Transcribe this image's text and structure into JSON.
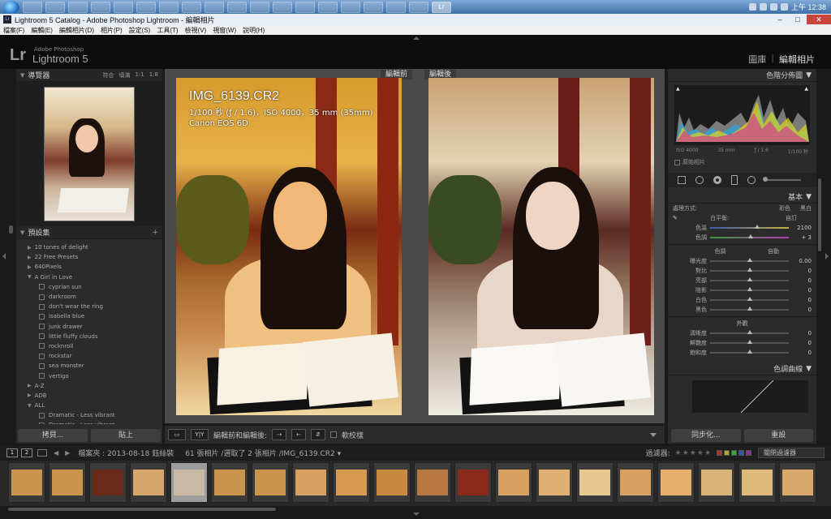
{
  "taskbar": {
    "apps": [
      "",
      "",
      "",
      "",
      "",
      "",
      "",
      "",
      "",
      "",
      "",
      "",
      "",
      "",
      "",
      "",
      "",
      "",
      "Lr"
    ],
    "clock": "上午 12:38"
  },
  "window": {
    "title": "Lightroom 5 Catalog - Adobe Photoshop Lightroom - 編輯相片",
    "buttons": [
      "–",
      "□",
      "✕"
    ]
  },
  "menu": [
    "檔案(F)",
    "編輯(E)",
    "編輯相片(D)",
    "相片(P)",
    "設定(S)",
    "工具(T)",
    "檢視(V)",
    "視窗(W)",
    "說明(H)"
  ],
  "identity": {
    "logo": "Lr",
    "brand_small": "Adobe Photoshop",
    "brand": "Lightroom 5",
    "modules": [
      "圖庫",
      "|",
      "編輯相片"
    ]
  },
  "left_panel": {
    "navigator": {
      "title": "導覽器",
      "zoom_options": [
        "符合",
        "填滿",
        "1:1",
        "1:8"
      ]
    },
    "presets": {
      "title": "預設集",
      "items": [
        {
          "type": "folder",
          "label": "10 tones of delight"
        },
        {
          "type": "folder",
          "label": "22 Free Presets"
        },
        {
          "type": "folder",
          "label": "640Pixels"
        },
        {
          "type": "folder-open",
          "label": "A Girl in Love"
        },
        {
          "type": "item",
          "label": "cyprian sun"
        },
        {
          "type": "item",
          "label": "darkroom"
        },
        {
          "type": "item",
          "label": "don't wear the ring"
        },
        {
          "type": "item",
          "label": "isabella blue"
        },
        {
          "type": "item",
          "label": "junk drawer"
        },
        {
          "type": "item",
          "label": "little fluffy clouds"
        },
        {
          "type": "item",
          "label": "rocknroll"
        },
        {
          "type": "item",
          "label": "rockstar"
        },
        {
          "type": "item",
          "label": "sea monster"
        },
        {
          "type": "item",
          "label": "vertigo"
        },
        {
          "type": "folder",
          "label": "A-Z"
        },
        {
          "type": "folder",
          "label": "ADB"
        },
        {
          "type": "folder-open",
          "label": "ALL"
        },
        {
          "type": "item",
          "label": "Dramatic - Less vibrant"
        },
        {
          "type": "item",
          "label": "Dramatic - Less vibrant"
        }
      ]
    },
    "copy_button": "拷貝...",
    "paste_button": "貼上"
  },
  "center": {
    "before_label": "編輯前",
    "after_label": "編輯後",
    "info": {
      "filename": "IMG_6139.CR2",
      "exif": "1/100 秒 (ƒ / 1.6)，ISO 4000，35 mm (35mm)",
      "camera": "Canon EOS 6D"
    },
    "toolbar": {
      "yy_label": "Y|Y",
      "compare_label": "編輯前和編輯後:",
      "softproof_label": "軟校樣"
    }
  },
  "right_panel": {
    "histogram_title": "色階分佈圖",
    "hist_info": [
      "ISO 4000",
      "35 mm",
      "ƒ / 1.6",
      "1/100 秒"
    ],
    "original_photo": "原始相片",
    "basic": {
      "title": "基本",
      "treatment_label": "處理方式:",
      "treatment_color": "彩色",
      "treatment_bw": "黑白",
      "wb_label": "白平衡:",
      "wb_value": "自訂",
      "sliders": [
        {
          "label": "色溫",
          "value": "2100",
          "pos": 0.6
        },
        {
          "label": "色調",
          "value": "+ 3",
          "pos": 0.52
        }
      ],
      "tone_title": "色調",
      "tone_auto": "自動",
      "tone_sliders": [
        {
          "label": "曝光度",
          "value": "0.00",
          "pos": 0.5
        },
        {
          "label": "對比",
          "value": "0",
          "pos": 0.5
        },
        {
          "label": "亮部",
          "value": "0",
          "pos": 0.5
        },
        {
          "label": "陰影",
          "value": "0",
          "pos": 0.5
        },
        {
          "label": "白色",
          "value": "0",
          "pos": 0.5
        },
        {
          "label": "黑色",
          "value": "0",
          "pos": 0.5
        }
      ],
      "presence_title": "外觀",
      "presence_sliders": [
        {
          "label": "清晰度",
          "value": "0",
          "pos": 0.5
        },
        {
          "label": "鮮艷度",
          "value": "0",
          "pos": 0.5
        },
        {
          "label": "飽和度",
          "value": "0",
          "pos": 0.5
        }
      ]
    },
    "tonecurve_title": "色調曲線",
    "sync_button": "同步化...",
    "reset_button": "重設"
  },
  "filmbar": {
    "view1": "1",
    "view2": "2",
    "breadcrumb": "檔案夾 : 2013-08-18 鈺絲裝",
    "count": "61 張相片 /選取了 2 張相片 /IMG_6139.CR2 ▾",
    "filter_label": "過濾器:",
    "stars": "★★★★★",
    "filter_off": "關閉過濾器"
  },
  "filmstrip": {
    "thumbs": [
      {
        "color": "#c9944c",
        "active": false
      },
      {
        "color": "#c9944c",
        "active": false
      },
      {
        "color": "#6a2a1a",
        "active": false
      },
      {
        "color": "#d6a66a",
        "active": false
      },
      {
        "color": "#c8b8a4",
        "active": true
      },
      {
        "color": "#c9944c",
        "active": false
      },
      {
        "color": "#c9944c",
        "active": false
      },
      {
        "color": "#d8a060",
        "active": false
      },
      {
        "color": "#d89a50",
        "active": false
      },
      {
        "color": "#c88a40",
        "active": false
      },
      {
        "color": "#b87840",
        "active": false
      },
      {
        "color": "#8a2a1a",
        "active": false
      },
      {
        "color": "#d8a060",
        "active": false
      },
      {
        "color": "#e0b070",
        "active": false
      },
      {
        "color": "#e8c890",
        "active": false
      },
      {
        "color": "#d8a060",
        "active": false
      },
      {
        "color": "#e4b06c",
        "active": false
      },
      {
        "color": "#d8b478",
        "active": false
      },
      {
        "color": "#e0b878",
        "active": false
      },
      {
        "color": "#d8a868",
        "active": false
      }
    ]
  }
}
